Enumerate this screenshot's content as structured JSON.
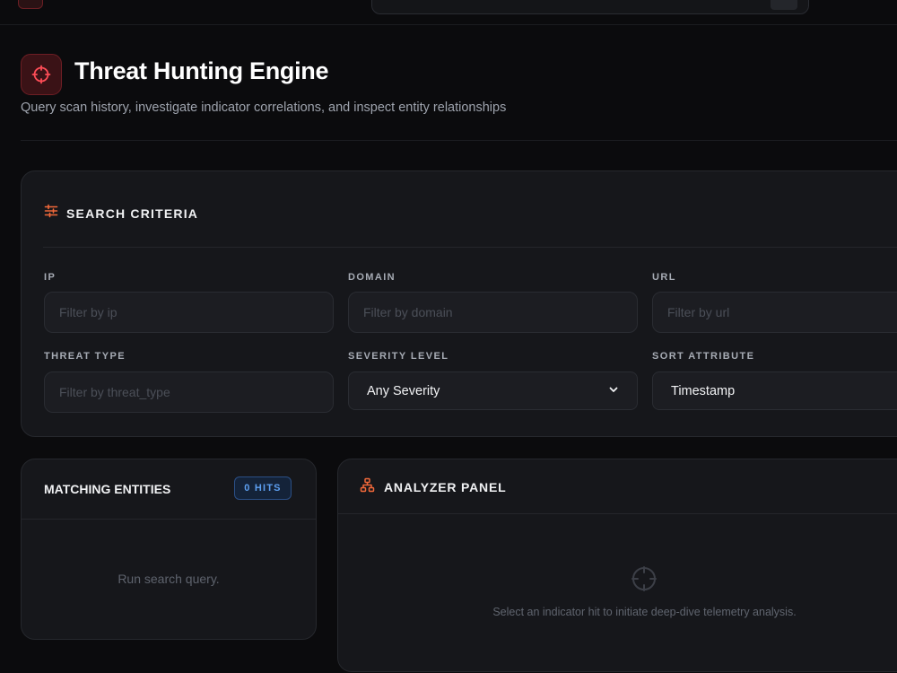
{
  "header": {
    "title": "Threat Hunting Engine",
    "subtitle": "Query scan history, investigate indicator correlations, and inspect entity relationships"
  },
  "criteria": {
    "title": "SEARCH CRITERIA",
    "fields": {
      "ip": {
        "label": "IP",
        "placeholder": "Filter by ip"
      },
      "domain": {
        "label": "DOMAIN",
        "placeholder": "Filter by domain"
      },
      "url": {
        "label": "URL",
        "placeholder": "Filter by url"
      },
      "threat_type": {
        "label": "THREAT TYPE",
        "placeholder": "Filter by threat_type"
      },
      "severity": {
        "label": "SEVERITY LEVEL",
        "value": "Any Severity"
      },
      "sort": {
        "label": "SORT ATTRIBUTE",
        "value": "Timestamp"
      }
    }
  },
  "entities": {
    "title": "MATCHING ENTITIES",
    "hits": "0 HITS",
    "empty": "Run search query."
  },
  "analyzer": {
    "title": "ANALYZER PANEL",
    "empty": "Select an indicator hit to initiate deep-dive telemetry analysis."
  },
  "colors": {
    "accent": "#e5484d",
    "accent_orange": "#f0683a",
    "badge_blue": "#5d9ff0",
    "background": "#0b0b0d",
    "card": "#16171b"
  }
}
